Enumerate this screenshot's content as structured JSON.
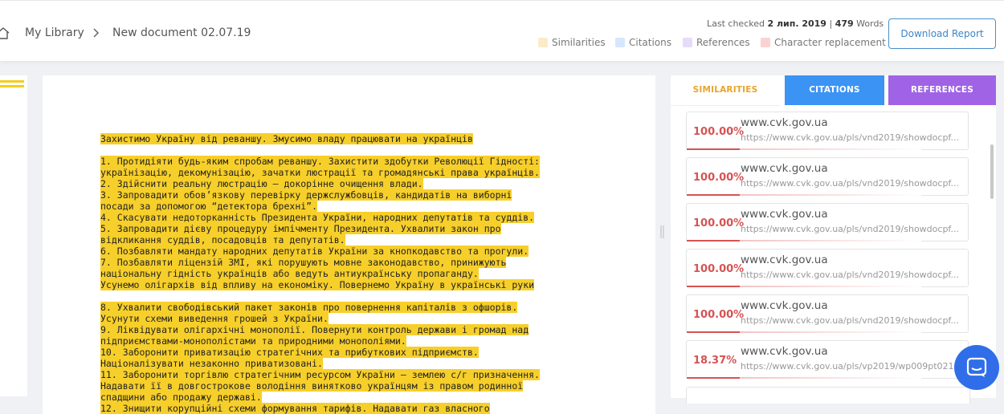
{
  "breadcrumb": {
    "library": "My Library",
    "document": "New document 02.07.19"
  },
  "header": {
    "last_checked_label": "Last checked",
    "last_checked_date": "2 лип. 2019",
    "separator": "|",
    "word_count": "479",
    "words_label": "Words",
    "download_label": "Download Report"
  },
  "legend": [
    {
      "label": "Similarities",
      "color": "#fcebc9"
    },
    {
      "label": "Citations",
      "color": "#d6e6fb"
    },
    {
      "label": "References",
      "color": "#e6dcf7"
    },
    {
      "label": "Character replacement",
      "color": "#fad2d2"
    }
  ],
  "document_lines": [
    "Захистимо Україну від реваншу. Змусимо владу працювати на українців",
    "",
    "1. Протидіяти будь-яким спробам реваншу. Захистити здобутки Революції Гідності:",
    "українізацію, декомунізацію, зачатки люстрації та громадянські права українців.",
    "2. Здійснити реальну люстрацію — докорінне очищення влади.",
    "3. Запровадити обов’язкову перевірку держслужбовців, кандидатів на виборні",
    "посади за допомогою “детектора брехні”.",
    "4. Скасувати недоторканність Президента України, народних депутатів та суддів.",
    "5. Запровадити дієву процедуру імпічменту Президента. Ухвалити закон про",
    "відкликання суддів, посадовців та депутатів.",
    "6. Позбавляти мандату народних депутатів України за кнопкодавство та прогули.",
    "7. Позбавляти ліцензій ЗМІ, які порушують мовне законодавство, принижують",
    "національну гідність українців або ведуть антиукраїнську пропаганду.",
    "Усунемо олігархів від впливу на економіку. Повернемо Україну в українські руки",
    "",
    "8. Ухвалити свободівський пакет законів про повернення капіталів з офшорів.",
    "Усунути схеми виведення грошей з України.",
    "9. Ліквідувати олігархічні монополії. Повернути контроль держави і громад над",
    "підприємствами-монополістами та природними монополіями.",
    "10. Заборонити приватизацію стратегічних та прибуткових підприємств.",
    "Націоналізувати незаконно приватизовані.",
    "11. Заборонити торгівлю стратегічним ресурсом України — землею с/г призначення.",
    "Надавати її в довгострокове володіння винятково українцям із правом родинної",
    "спадщини або продажу державі.",
    "12. Знищити корупційні схеми формування тарифів. Надавати газ власного"
  ],
  "tabs": {
    "similarities": "SIMILARITIES",
    "citations": "CITATIONS",
    "references": "REFERENCES"
  },
  "results": [
    {
      "percent": "100.00%",
      "value": 1.0,
      "site": "www.cvk.gov.ua",
      "url": "https://www.cvk.gov.ua/pls/vnd2019/showdocpf..."
    },
    {
      "percent": "100.00%",
      "value": 1.0,
      "site": "www.cvk.gov.ua",
      "url": "https://www.cvk.gov.ua/pls/vnd2019/showdocpf..."
    },
    {
      "percent": "100.00%",
      "value": 1.0,
      "site": "www.cvk.gov.ua",
      "url": "https://www.cvk.gov.ua/pls/vnd2019/showdocpf..."
    },
    {
      "percent": "100.00%",
      "value": 1.0,
      "site": "www.cvk.gov.ua",
      "url": "https://www.cvk.gov.ua/pls/vnd2019/showdocpf..."
    },
    {
      "percent": "100.00%",
      "value": 1.0,
      "site": "www.cvk.gov.ua",
      "url": "https://www.cvk.gov.ua/pls/vnd2019/showdocpf..."
    },
    {
      "percent": "18.37%",
      "value": 0.1837,
      "site": "www.cvk.gov.ua",
      "url": "https://www.cvk.gov.ua/pls/vp2019/wp009pt021..."
    }
  ],
  "icons": {
    "home": "home-icon",
    "breadcrumb_separator": "chevron-right-icon",
    "chat": "chat-icon",
    "splitter": "drag-handle-icon"
  },
  "colors": {
    "highlight": "#f7cf2a",
    "similarity_tab": "#e8a52c",
    "citations_tab": "#3b93f4",
    "references_tab": "#a063e6",
    "match": "#d65353",
    "chat": "#2f6ee8"
  }
}
